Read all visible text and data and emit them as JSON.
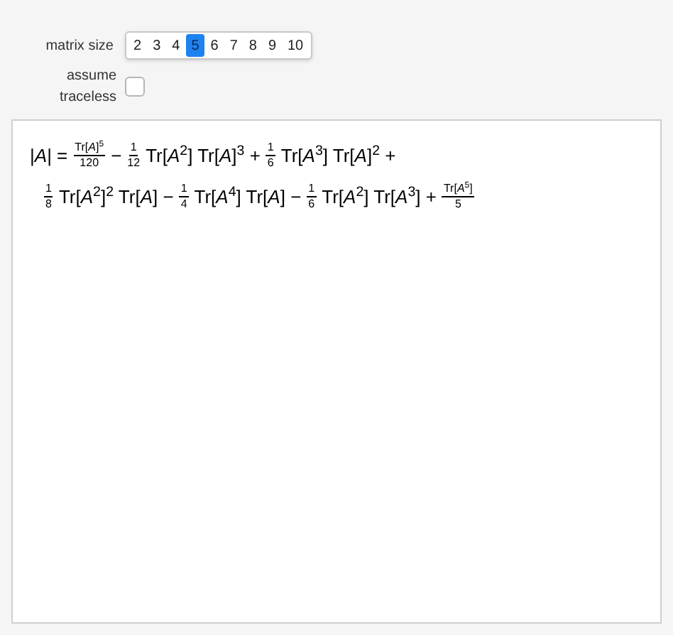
{
  "controls": {
    "matrix_size": {
      "label": "matrix size",
      "options": [
        {
          "label": "2",
          "selected": false
        },
        {
          "label": "3",
          "selected": false
        },
        {
          "label": "4",
          "selected": false
        },
        {
          "label": "5",
          "selected": true
        },
        {
          "label": "6",
          "selected": false
        },
        {
          "label": "7",
          "selected": false
        },
        {
          "label": "8",
          "selected": false
        },
        {
          "label": "9",
          "selected": false
        },
        {
          "label": "10",
          "selected": false
        }
      ]
    },
    "traceless": {
      "label": "assume traceless",
      "checked": false
    }
  },
  "formula": [
    [
      {
        "kind": "text",
        "text": "|*A*| ="
      },
      {
        "kind": "frac",
        "num": "Tr[*A*]$^{5}$",
        "den": "120"
      },
      {
        "kind": "text",
        "text": "−"
      },
      {
        "kind": "frac",
        "num": "1",
        "den": "12"
      },
      {
        "kind": "text",
        "text": "Tr[*A*$^{2}$] Tr[*A*]$^{3}$ +"
      },
      {
        "kind": "frac",
        "num": "1",
        "den": "6"
      },
      {
        "kind": "text",
        "text": "Tr[*A*$^{3}$] Tr[*A*]$^{2}$ +"
      }
    ],
    [
      {
        "kind": "frac",
        "num": "1",
        "den": "8"
      },
      {
        "kind": "text",
        "text": "Tr[*A*$^{2}$]$^{2}$ Tr[*A*] −"
      },
      {
        "kind": "frac",
        "num": "1",
        "den": "4"
      },
      {
        "kind": "text",
        "text": "Tr[*A*$^{4}$] Tr[*A*] −"
      },
      {
        "kind": "frac",
        "num": "1",
        "den": "6"
      },
      {
        "kind": "text",
        "text": "Tr[*A*$^{2}$] Tr[*A*$^{3}$] +"
      },
      {
        "kind": "frac",
        "num": "Tr[*A*$^{5}$]",
        "den": "5"
      }
    ]
  ]
}
